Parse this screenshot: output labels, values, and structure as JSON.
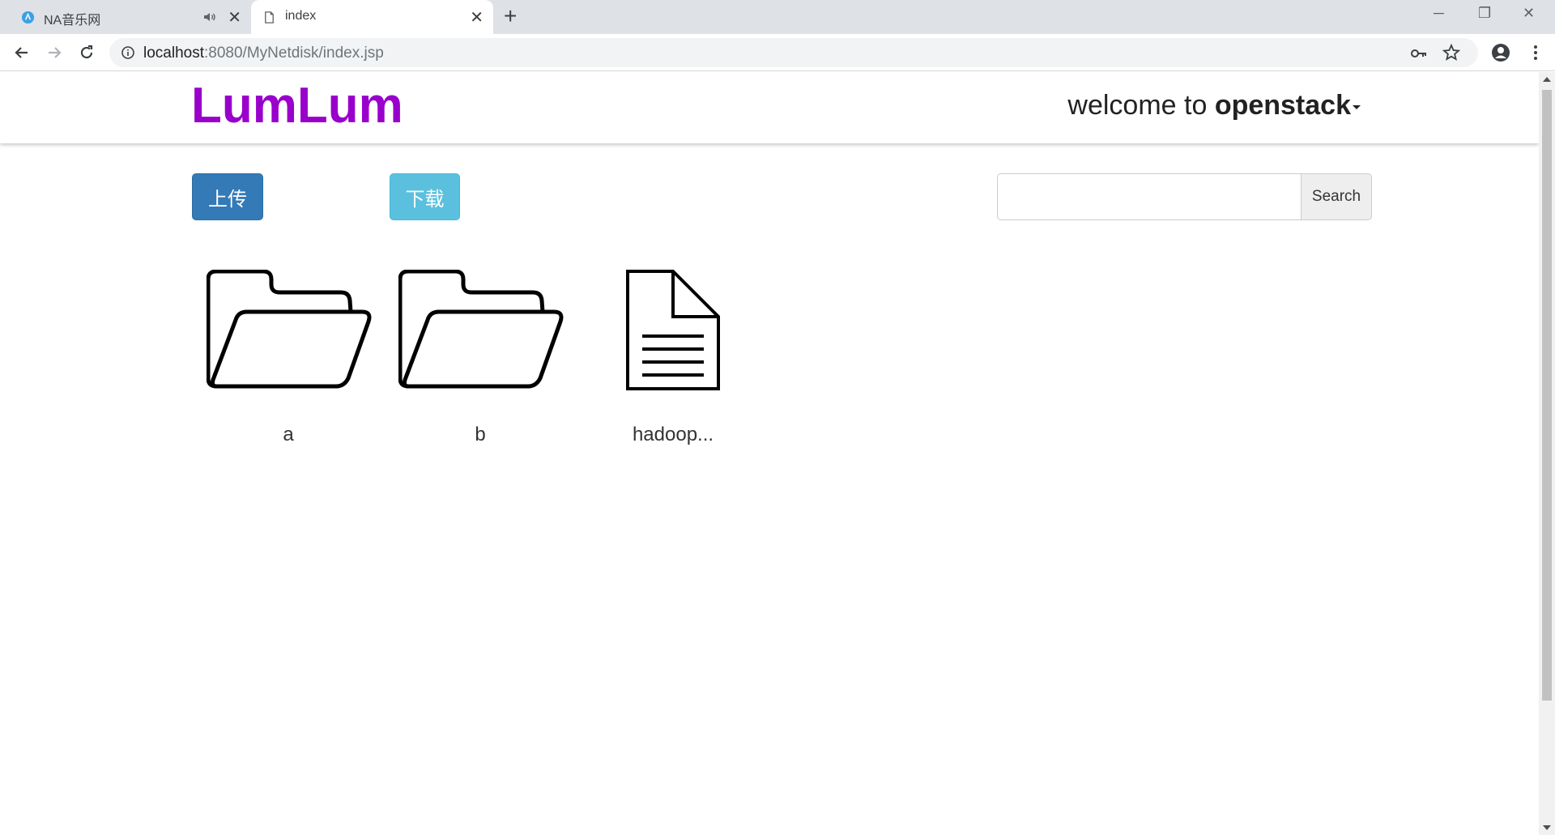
{
  "browser": {
    "tabs": [
      {
        "title": "NA音乐网",
        "active": false,
        "audio": true
      },
      {
        "title": "index",
        "active": true,
        "audio": false
      }
    ],
    "url_host": "localhost",
    "url_rest": ":8080/MyNetdisk/index.jsp"
  },
  "page": {
    "brand": "LumLum",
    "brand_color": "#9900cc",
    "welcome_prefix": "welcome to ",
    "username": "openstack",
    "upload_label": "上传",
    "download_label": "下载",
    "search_placeholder": "",
    "search_label": "Search",
    "files": [
      {
        "name": "a",
        "kind": "folder"
      },
      {
        "name": "b",
        "kind": "folder"
      },
      {
        "name": "hadoop...",
        "kind": "file"
      }
    ]
  }
}
